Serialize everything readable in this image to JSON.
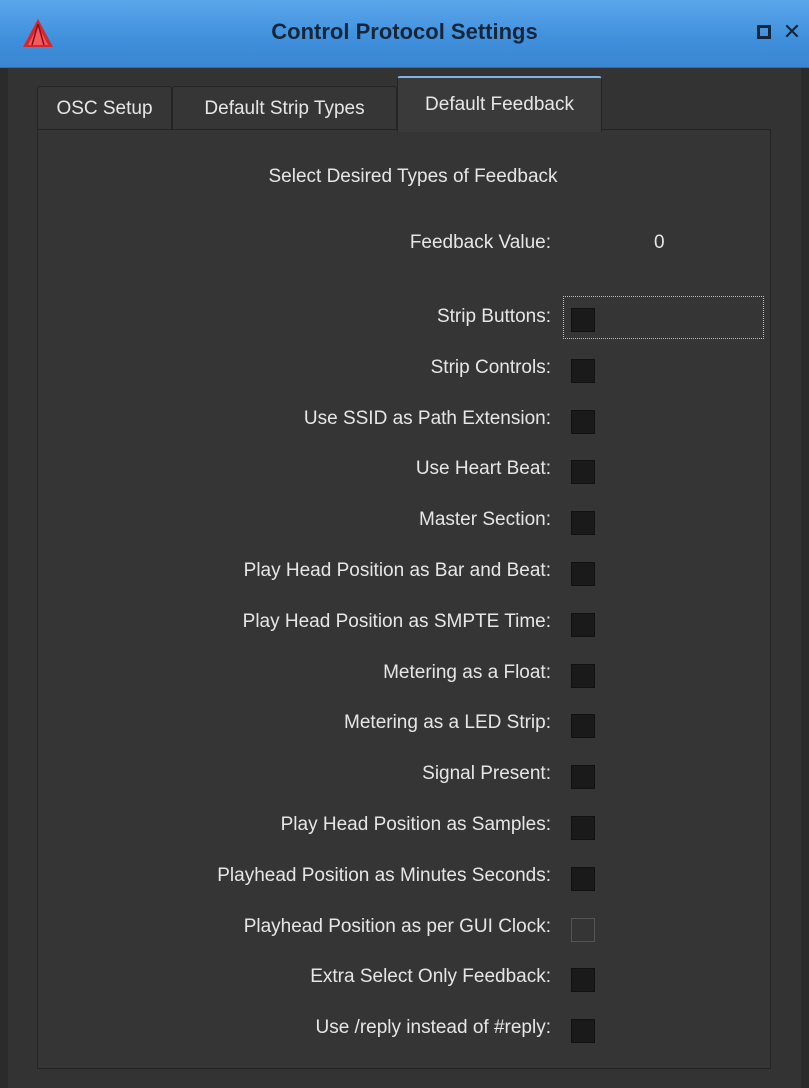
{
  "window": {
    "title": "Control Protocol Settings",
    "maximize_icon": "maximize-icon",
    "close_glyph": "✕"
  },
  "tabs": [
    {
      "label": "OSC Setup",
      "active": false
    },
    {
      "label": "Default Strip Types",
      "active": false
    },
    {
      "label": "Default Feedback",
      "active": true
    }
  ],
  "panel": {
    "heading": "Select Desired Types of Feedback",
    "feedback_value_label": "Feedback Value:",
    "feedback_value": "0",
    "options": [
      {
        "label": "Strip Buttons:",
        "checked": true
      },
      {
        "label": "Strip Controls:",
        "checked": true
      },
      {
        "label": "Use SSID as Path Extension:",
        "checked": true
      },
      {
        "label": "Use Heart Beat:",
        "checked": true
      },
      {
        "label": "Master Section:",
        "checked": true
      },
      {
        "label": "Play Head Position as Bar and Beat:",
        "checked": true
      },
      {
        "label": "Play Head Position as SMPTE Time:",
        "checked": true
      },
      {
        "label": "Metering as a Float:",
        "checked": true
      },
      {
        "label": "Metering as a LED Strip:",
        "checked": true
      },
      {
        "label": "Signal Present:",
        "checked": true
      },
      {
        "label": "Play Head Position as Samples:",
        "checked": true
      },
      {
        "label": "Playhead Position as Minutes Seconds:",
        "checked": true
      },
      {
        "label": "Playhead Position as per GUI Clock:",
        "checked": false
      },
      {
        "label": "Extra Select Only Feedback:",
        "checked": true
      },
      {
        "label": "Use /reply instead of #reply:",
        "checked": true
      }
    ]
  },
  "colors": {
    "titlebar": "#3f8fdc",
    "background": "#333333",
    "accent_tab": "#7fb3e6",
    "logo": "#e0262e"
  }
}
